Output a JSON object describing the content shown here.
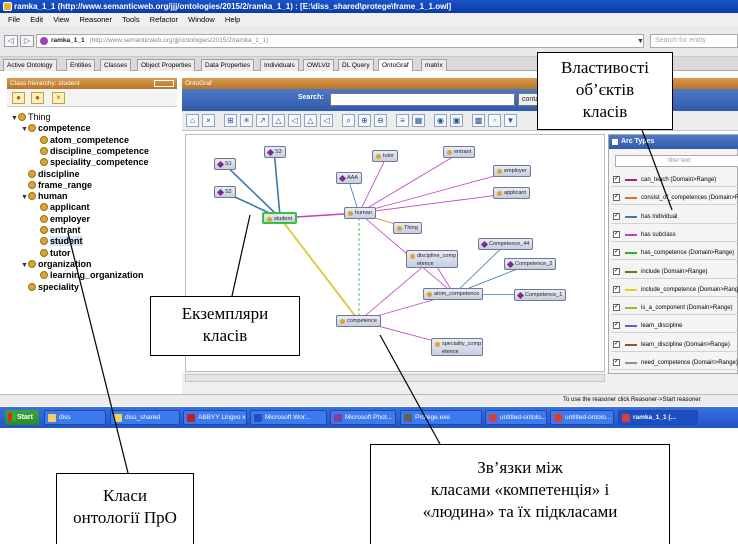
{
  "window": {
    "title": "ramka_1_1 (http://www.semanticweb.org/jjj/ontologies/2015/2/ramka_1_1) : [E:\\diss_shared\\protege\\frame_1_1.owl]"
  },
  "menu": [
    "File",
    "Edit",
    "View",
    "Reasoner",
    "Tools",
    "Refactor",
    "Window",
    "Help"
  ],
  "navigation": {
    "back_label": "◁",
    "forward_label": "▷",
    "ontology_name": "ramka_1_1",
    "ontology_url": "(http://www.semanticweb.org/jjj/ontologies/2015/2/ramka_1_1)",
    "entity_search_placeholder": "Search for entity"
  },
  "tabs": [
    "Active Ontology",
    "Entities",
    "Classes",
    "Object Properties",
    "Data Properties",
    "Individuals",
    "OWLViz",
    "DL Query",
    "OntoGraf",
    "matrix"
  ],
  "active_tab": "OntoGraf",
  "class_hierarchy": {
    "header": "Class hierarchy: student",
    "tree": [
      {
        "label": "Thing",
        "toggle": "▼",
        "bold": false
      },
      {
        "label": "competence",
        "toggle": "▼",
        "bold": true
      },
      {
        "label": "atom_competence",
        "toggle": "",
        "bold": true
      },
      {
        "label": "discipline_competence",
        "toggle": "",
        "bold": true
      },
      {
        "label": "speciality_competence",
        "toggle": "",
        "bold": true
      },
      {
        "label": "discipline",
        "toggle": "",
        "bold": true
      },
      {
        "label": "frame_range",
        "toggle": "",
        "bold": true
      },
      {
        "label": "human",
        "toggle": "▼",
        "bold": true
      },
      {
        "label": "applicant",
        "toggle": "",
        "bold": true
      },
      {
        "label": "employer",
        "toggle": "",
        "bold": true
      },
      {
        "label": "entrant",
        "toggle": "",
        "bold": true
      },
      {
        "label": "student",
        "toggle": "",
        "bold": true,
        "selected": true
      },
      {
        "label": "tutor",
        "toggle": "",
        "bold": true
      },
      {
        "label": "organization",
        "toggle": "▼",
        "bold": true
      },
      {
        "label": "learning_organization",
        "toggle": "",
        "bold": true
      },
      {
        "label": "speciality",
        "toggle": "",
        "bold": true
      }
    ]
  },
  "ontograf": {
    "header": "OntoGraf",
    "search_label": "Search:",
    "search_mode": "contains",
    "nodes": [
      {
        "id": "s1",
        "label": "S1",
        "kind": "individual"
      },
      {
        "id": "s3",
        "label": "S3",
        "kind": "individual"
      },
      {
        "id": "s2",
        "label": "S2",
        "kind": "individual"
      },
      {
        "id": "aaa",
        "label": "AAA",
        "kind": "individual"
      },
      {
        "id": "tutor",
        "label": "tutor",
        "kind": "class"
      },
      {
        "id": "entrant",
        "label": "entrant",
        "kind": "class"
      },
      {
        "id": "employer",
        "label": "employer",
        "kind": "class"
      },
      {
        "id": "applicant",
        "label": "applicant",
        "kind": "class"
      },
      {
        "id": "student",
        "label": "student",
        "kind": "class",
        "selected": true
      },
      {
        "id": "human",
        "label": "human",
        "kind": "class"
      },
      {
        "id": "thing",
        "label": "Thing",
        "kind": "class"
      },
      {
        "id": "comp44",
        "label": "Competence_44",
        "kind": "individual"
      },
      {
        "id": "disccomp",
        "label": "discipline_comp etence",
        "kind": "class"
      },
      {
        "id": "comp2",
        "label": "Competence_2",
        "kind": "individual"
      },
      {
        "id": "atomcomp",
        "label": "atom_competence",
        "kind": "class"
      },
      {
        "id": "comp1",
        "label": "Competence_1",
        "kind": "individual"
      },
      {
        "id": "competence",
        "label": "competence",
        "kind": "class"
      },
      {
        "id": "speccomp",
        "label": "speciality_comp etence",
        "kind": "class"
      }
    ]
  },
  "arcs": {
    "header": "Arc Types",
    "filter_placeholder": "filter text",
    "items": [
      {
        "label": "can_teach (Domain>Range)",
        "color": "#a020a0"
      },
      {
        "label": "consist_of_competences (Domain>Range)",
        "color": "#e07020"
      },
      {
        "label": "has individual",
        "color": "#3a7ab0"
      },
      {
        "label": "has subclass",
        "color": "#c040c0"
      },
      {
        "label": "has_competence (Domain>Range)",
        "color": "#30b030"
      },
      {
        "label": "include (Domain>Range)",
        "color": "#707020"
      },
      {
        "label": "include_competence (Domain>Range)",
        "color": "#e8d020"
      },
      {
        "label": "is_a_component (Domain>Range)",
        "color": "#b0b030"
      },
      {
        "label": "learn_discipline",
        "color": "#6060d0"
      },
      {
        "label": "learn_discipline (Domain>Range)",
        "color": "#806020"
      },
      {
        "label": "need_competence (Domain>Range)",
        "color": "#909090"
      }
    ]
  },
  "status": "To use the reasoner click Reasoner->Start reasoner",
  "taskbar": {
    "start": "Start",
    "items": [
      {
        "label": "diss",
        "color": "#f5d060"
      },
      {
        "label": "diss_shared",
        "color": "#f5d060"
      },
      {
        "label": "ABBYY Lingvo x3",
        "color": "#c02020"
      },
      {
        "label": "Microsoft Wor...",
        "color": "#2050c0"
      },
      {
        "label": "Microsoft Phot...",
        "color": "#8040a0"
      },
      {
        "label": "Protege.exe",
        "color": "#606060"
      },
      {
        "label": "untitled-ontolo...",
        "color": "#d04040"
      },
      {
        "label": "untitled-ontolo...",
        "color": "#d04040"
      },
      {
        "label": "ramka_1_1 (...",
        "color": "#d04040"
      }
    ]
  },
  "callouts": {
    "properties": [
      "Властивості",
      "об’єктів",
      "класів"
    ],
    "instances": [
      "Екземпляри",
      "класів"
    ],
    "classes": [
      "Класи",
      "онтології ПрО"
    ],
    "relations": [
      "Зв’язки між",
      "класами «компетенція» і",
      "«людина» та їх підкласами"
    ]
  }
}
